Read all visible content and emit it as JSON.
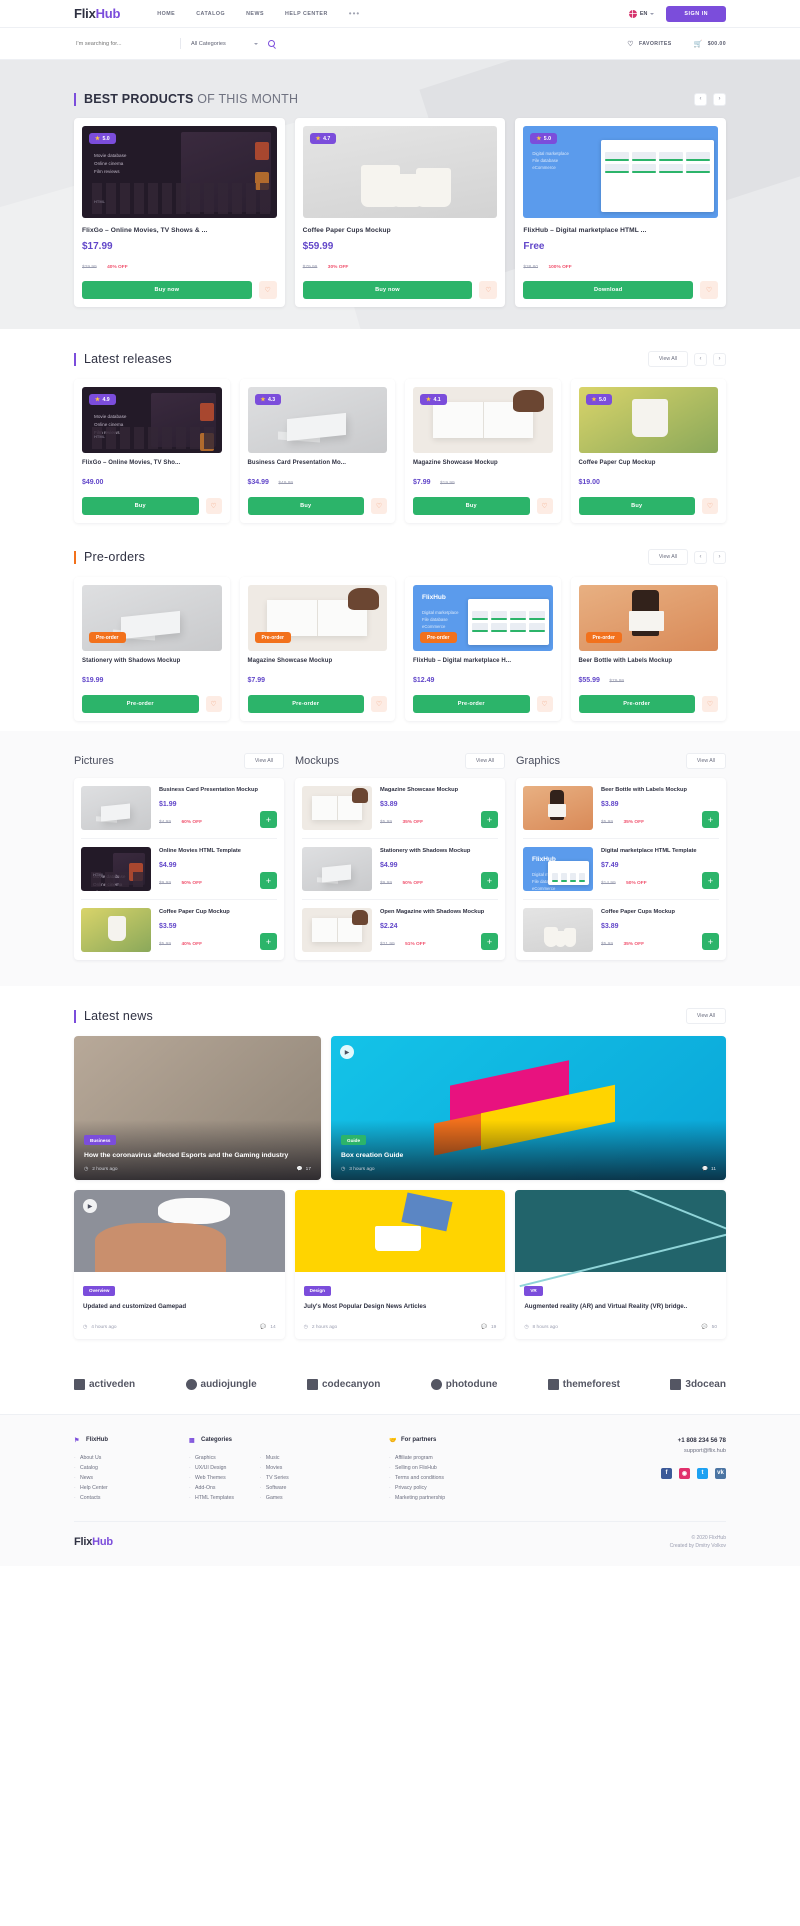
{
  "header": {
    "logo_a": "Flix",
    "logo_b": "Hub",
    "nav": [
      "HOME",
      "CATALOG",
      "NEWS",
      "HELP CENTER"
    ],
    "nav_more": "•••",
    "language": "EN",
    "signin": "SIGN IN"
  },
  "search": {
    "placeholder": "I'm searching for...",
    "category": "All Categories",
    "favorites": "FAVORITES",
    "cart_total": "$00.00"
  },
  "best": {
    "title_bold": "BEST PRODUCTS",
    "title_rest": " OF THIS MONTH",
    "prev": "‹",
    "next": "›",
    "items": [
      {
        "rating": "5.0",
        "title": "FlixGo – Online Movies, TV Shows & ...",
        "price": "$17.99",
        "old": "$29.99",
        "off": "40% OFF",
        "button": "Buy now",
        "art": "dark"
      },
      {
        "rating": "4.7",
        "title": "Coffee Paper Cups Mockup",
        "price": "$59.99",
        "old": "$79.99",
        "off": "30% OFF",
        "button": "Buy now",
        "art": "cups"
      },
      {
        "rating": "5.0",
        "title": "FlixHub – Digital marketplace HTML ...",
        "price": "Free",
        "old": "$38.80",
        "off": "100% OFF",
        "button": "Download",
        "art": "blue"
      }
    ]
  },
  "latest": {
    "title": "Latest releases",
    "view_all": "View All",
    "prev": "‹",
    "next": "›",
    "items": [
      {
        "rating": "4.9",
        "title": "FlixGo – Online Movies, TV Sho...",
        "price": "$49.00",
        "old": "",
        "button": "Buy",
        "art": "dark"
      },
      {
        "rating": "4.3",
        "title": "Business Card Presentation Mo...",
        "price": "$34.99",
        "old": "$49.99",
        "button": "Buy",
        "art": "grey"
      },
      {
        "rating": "4.1",
        "title": "Magazine Showcase Mockup",
        "price": "$7.99",
        "old": "$19.99",
        "button": "Buy",
        "art": "paper"
      },
      {
        "rating": "5.0",
        "title": "Coffee Paper Cup Mockup",
        "price": "$19.00",
        "old": "",
        "button": "Buy",
        "art": "food"
      }
    ]
  },
  "preorders": {
    "title": "Pre-orders",
    "view_all": "View All",
    "prev": "‹",
    "next": "›",
    "badge": "Pre-order",
    "items": [
      {
        "title": "Stationery with Shadows Mockup",
        "price": "$19.99",
        "old": "",
        "button": "Pre-order",
        "art": "grey"
      },
      {
        "title": "Magazine Showcase Mockup",
        "price": "$7.99",
        "old": "",
        "button": "Pre-order",
        "art": "paper"
      },
      {
        "title": "FlixHub – Digital marketplace H...",
        "price": "$12.49",
        "old": "",
        "button": "Pre-order",
        "art": "blue"
      },
      {
        "title": "Beer Bottle with Labels Mockup",
        "price": "$55.99",
        "old": "$79.99",
        "button": "Pre-order",
        "art": "bottle"
      }
    ]
  },
  "columns": [
    {
      "title": "Pictures",
      "view_all": "View All",
      "items": [
        {
          "title": "Business Card Presentation Mockup",
          "price": "$1.99",
          "old": "$4.99",
          "off": "60% OFF",
          "art": "grey"
        },
        {
          "title": "Online Movies HTML Template",
          "price": "$4.99",
          "old": "$9.99",
          "off": "50% OFF",
          "art": "dark"
        },
        {
          "title": "Coffee Paper Cup Mockup",
          "price": "$3.59",
          "old": "$5.99",
          "off": "40% OFF",
          "art": "food"
        }
      ]
    },
    {
      "title": "Mockups",
      "view_all": "View All",
      "items": [
        {
          "title": "Magazine Showcase Mockup",
          "price": "$3.89",
          "old": "$5.99",
          "off": "35% OFF",
          "art": "paper"
        },
        {
          "title": "Stationery with Shadows Mockup",
          "price": "$4.99",
          "old": "$9.99",
          "off": "50% OFF",
          "art": "grey"
        },
        {
          "title": "Open Magazine with Shadows Mockup",
          "price": "$2.24",
          "old": "$21.99",
          "off": "51% OFF",
          "art": "paper"
        }
      ]
    },
    {
      "title": "Graphics",
      "view_all": "View All",
      "items": [
        {
          "title": "Beer Bottle with Labels Mockup",
          "price": "$3.89",
          "old": "$5.99",
          "off": "35% OFF",
          "art": "bottle"
        },
        {
          "title": "Digital marketplace HTML Template",
          "price": "$7.49",
          "old": "$14.99",
          "off": "50% OFF",
          "art": "blue"
        },
        {
          "title": "Coffee Paper Cups Mockup",
          "price": "$3.89",
          "old": "$5.99",
          "off": "35% OFF",
          "art": "cups"
        }
      ]
    }
  ],
  "news": {
    "title": "Latest news",
    "view_all": "View All",
    "featured": [
      {
        "tag": "Business",
        "tag_color": "#7b4ddb",
        "title": "How the coronavirus affected Esports and the Gaming industry",
        "time": "2 hours ago",
        "comments": "17",
        "art": "couch"
      },
      {
        "tag": "Guide",
        "tag_color": "#2cb46a",
        "title": "Box creation Guide",
        "time": "3 hours ago",
        "comments": "11",
        "art": "boxes"
      }
    ],
    "small": [
      {
        "tag": "Overview",
        "tag_color": "#7b4ddb",
        "title": "Updated and customized Gamepad",
        "time": "4 hours ago",
        "comments": "14",
        "art": "pad",
        "has_play": true
      },
      {
        "tag": "Design",
        "tag_color": "#7b4ddb",
        "title": "July's Most Popular Design News Articles",
        "time": "2 hours ago",
        "comments": "19",
        "art": "yellow",
        "has_play": false
      },
      {
        "tag": "VR",
        "tag_color": "#7b4ddb",
        "title": "Augmented reality (AR) and Virtual Reality (VR) bridge..",
        "time": "8 hours ago",
        "comments": "50",
        "art": "court",
        "has_play": false
      }
    ]
  },
  "brands": [
    "activeden",
    "audiojungle",
    "codecanyon",
    "photodune",
    "themeforest",
    "3docean"
  ],
  "footer": {
    "columns": [
      {
        "head": "FlixHub",
        "icon": "flag-icon",
        "lists": [
          [
            "About Us",
            "Catalog",
            "News",
            "Help Center",
            "Contacts"
          ]
        ]
      },
      {
        "head": "Categories",
        "icon": "grid-icon",
        "lists": [
          [
            "Graphics",
            "UX/UI Design",
            "Web Themes",
            "Add-Ons",
            "HTML Templates"
          ],
          [
            "Music",
            "Movies",
            "TV Series",
            "Software",
            "Games"
          ]
        ]
      },
      {
        "head": "For partners",
        "icon": "handshake-icon",
        "lists": [
          [
            "Affiliate program",
            "Selling on FlixHub",
            "Terms and conditions",
            "Privacy policy",
            "Marketing partnership"
          ]
        ]
      }
    ],
    "phone": "+1 808 234 56 78",
    "email": "support@flix.hub",
    "socials": [
      "f",
      "◉",
      "t",
      "vk"
    ],
    "logo_a": "Flix",
    "logo_b": "Hub",
    "copyright": "© 2020 FlixHub",
    "credit": "Created by Dmitry Volkov"
  }
}
